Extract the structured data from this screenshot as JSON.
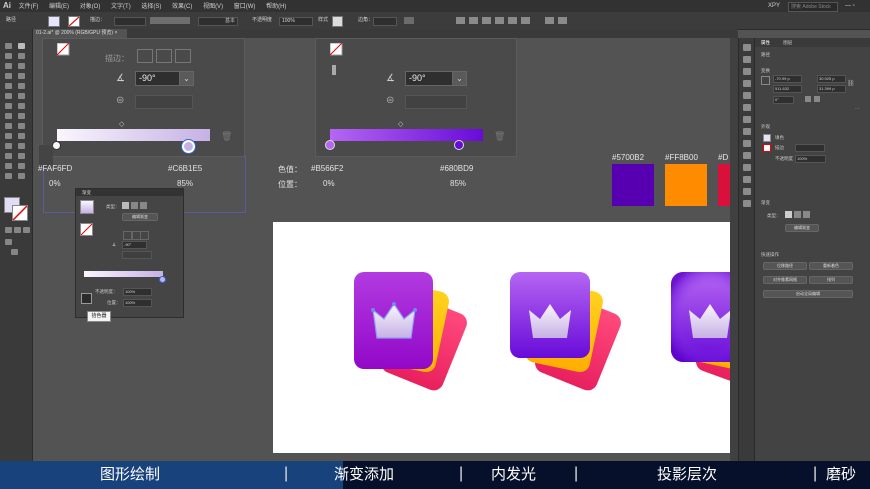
{
  "menubar": {
    "logo": "Ai",
    "items": [
      "文件(F)",
      "编辑(E)",
      "对象(O)",
      "文字(T)",
      "选择(S)",
      "效果(C)",
      "视图(V)",
      "窗口(W)",
      "帮助(H)"
    ],
    "workspace": "XPY",
    "search_placeholder": "搜索 Adobe Stock"
  },
  "control_bar": {
    "selection": "路径",
    "stroke_label": "描边：",
    "stroke_style": "基本",
    "opacity_label": "不透明度",
    "opacity": "100%",
    "style_label": "样式",
    "corner_label": "边角："
  },
  "doc_tab": {
    "title": "01-2.ai* @ 200% (RGB/GPU 预览)",
    "close": "×"
  },
  "left_panel": {
    "stroke_label": "描边：",
    "angle": "-90°",
    "color1": "#FAF6FD",
    "color2": "#C6B1E5",
    "pos1": "0%",
    "pos2": "85%"
  },
  "right_panel": {
    "angle": "-90°",
    "color_label": "色值：",
    "position_label": "位置：",
    "color1": "#B566F2",
    "color2": "#680BD9",
    "pos1": "0%",
    "pos2": "85%"
  },
  "swatches": [
    {
      "label": "#5700B2",
      "color": "#5700B2"
    },
    {
      "label": "#FF8B00",
      "color": "#FF8B00"
    },
    {
      "label": "#D",
      "color": "#D8103A"
    }
  ],
  "float_panel": {
    "title": "渐变",
    "type_label": "类型：",
    "edit_button": "编辑渐变",
    "angle": "-90°",
    "opacity_label": "不透明度：",
    "opacity": "100%",
    "location_label": "位置：",
    "location": "100%",
    "tooltip": "拾色器"
  },
  "properties_panel": {
    "tabs": [
      "属性",
      "图层"
    ],
    "section_path": "路径",
    "section_transform": "变换",
    "x": "-70.99 p",
    "y": "511.632",
    "w": "30.925 p",
    "h": "31.399 p",
    "angle": "0°",
    "section_appearance": "外观",
    "fill_label": "填色",
    "stroke_label": "描边",
    "opacity_label": "不透明度",
    "opacity": "100%",
    "section_gradient": "渐变",
    "type_label": "类型：",
    "edit_gradient": "编辑渐变",
    "section_quick": "快速操作",
    "btn_offset": "位移路径",
    "btn_recolor": "重新着色",
    "btn_align": "对齐像素网格",
    "btn_arrange": "排列",
    "btn_start": "启动全局编辑"
  },
  "bottom_bar": {
    "items": [
      "图形绘制",
      "渐变添加",
      "内发光",
      "投影层次",
      "磨砂"
    ],
    "separator": "|"
  },
  "colors": {
    "accent_gradient_start": "#B566F2",
    "accent_gradient_end": "#680BD9",
    "bottom_bar": "#07102a",
    "bottom_highlight": "#1d4a8c"
  }
}
